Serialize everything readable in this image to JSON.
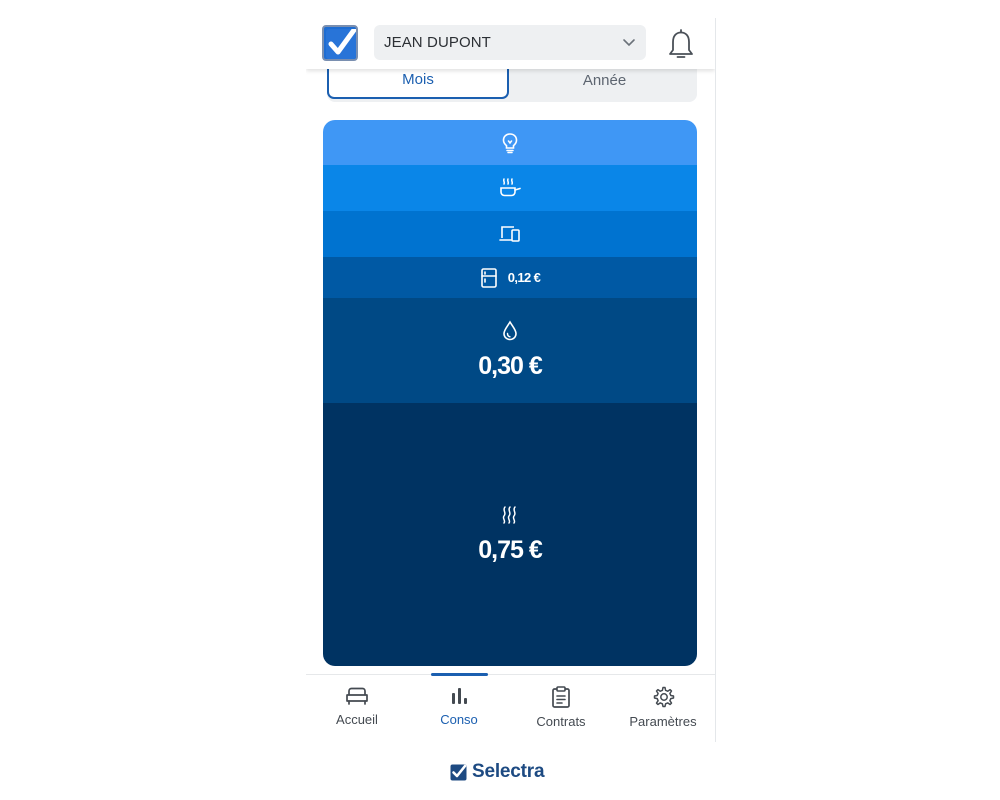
{
  "header": {
    "user_name": "JEAN DUPONT",
    "logo_icon": "checkbox-check-icon",
    "notification_icon": "bell-icon"
  },
  "period_toggle": {
    "options": [
      "Mois",
      "Année"
    ],
    "selected": "Mois"
  },
  "consumption_breakdown": [
    {
      "category_icon": "lightbulb-icon",
      "amount": "",
      "color": "#3f97f5",
      "share": 0.082
    },
    {
      "category_icon": "cooking-pot-icon",
      "amount": "",
      "color": "#0a86e8",
      "share": 0.084
    },
    {
      "category_icon": "devices-icon",
      "amount": "",
      "color": "#0073d0",
      "share": 0.084
    },
    {
      "category_icon": "fridge-icon",
      "amount": "0,12 €",
      "color": "#0059a4",
      "share": 0.075
    },
    {
      "category_icon": "water-drop-icon",
      "amount": "0,30 €",
      "color": "#004985",
      "share": 0.192
    },
    {
      "category_icon": "heating-waves-icon",
      "amount": "0,75 €",
      "color": "#003362",
      "share": 0.483
    }
  ],
  "bottom_nav": {
    "items": [
      {
        "label": "Accueil",
        "icon": "sofa-icon",
        "active": false
      },
      {
        "label": "Conso",
        "icon": "bar-chart-icon",
        "active": true
      },
      {
        "label": "Contrats",
        "icon": "clipboard-icon",
        "active": false
      },
      {
        "label": "Paramètres",
        "icon": "gear-icon",
        "active": false
      }
    ]
  },
  "brand": {
    "name": "Selectra"
  }
}
